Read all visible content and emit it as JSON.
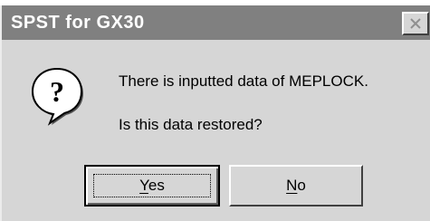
{
  "window": {
    "title": "SPST for GX30",
    "close_icon": "close-icon"
  },
  "message": {
    "icon": "question-icon",
    "line1": "There is inputted data of MEPLOCK.",
    "line2": "Is this data restored?"
  },
  "buttons": {
    "yes": {
      "mnemonic": "Y",
      "rest": "es"
    },
    "no": {
      "mnemonic": "N",
      "rest": "o"
    }
  }
}
